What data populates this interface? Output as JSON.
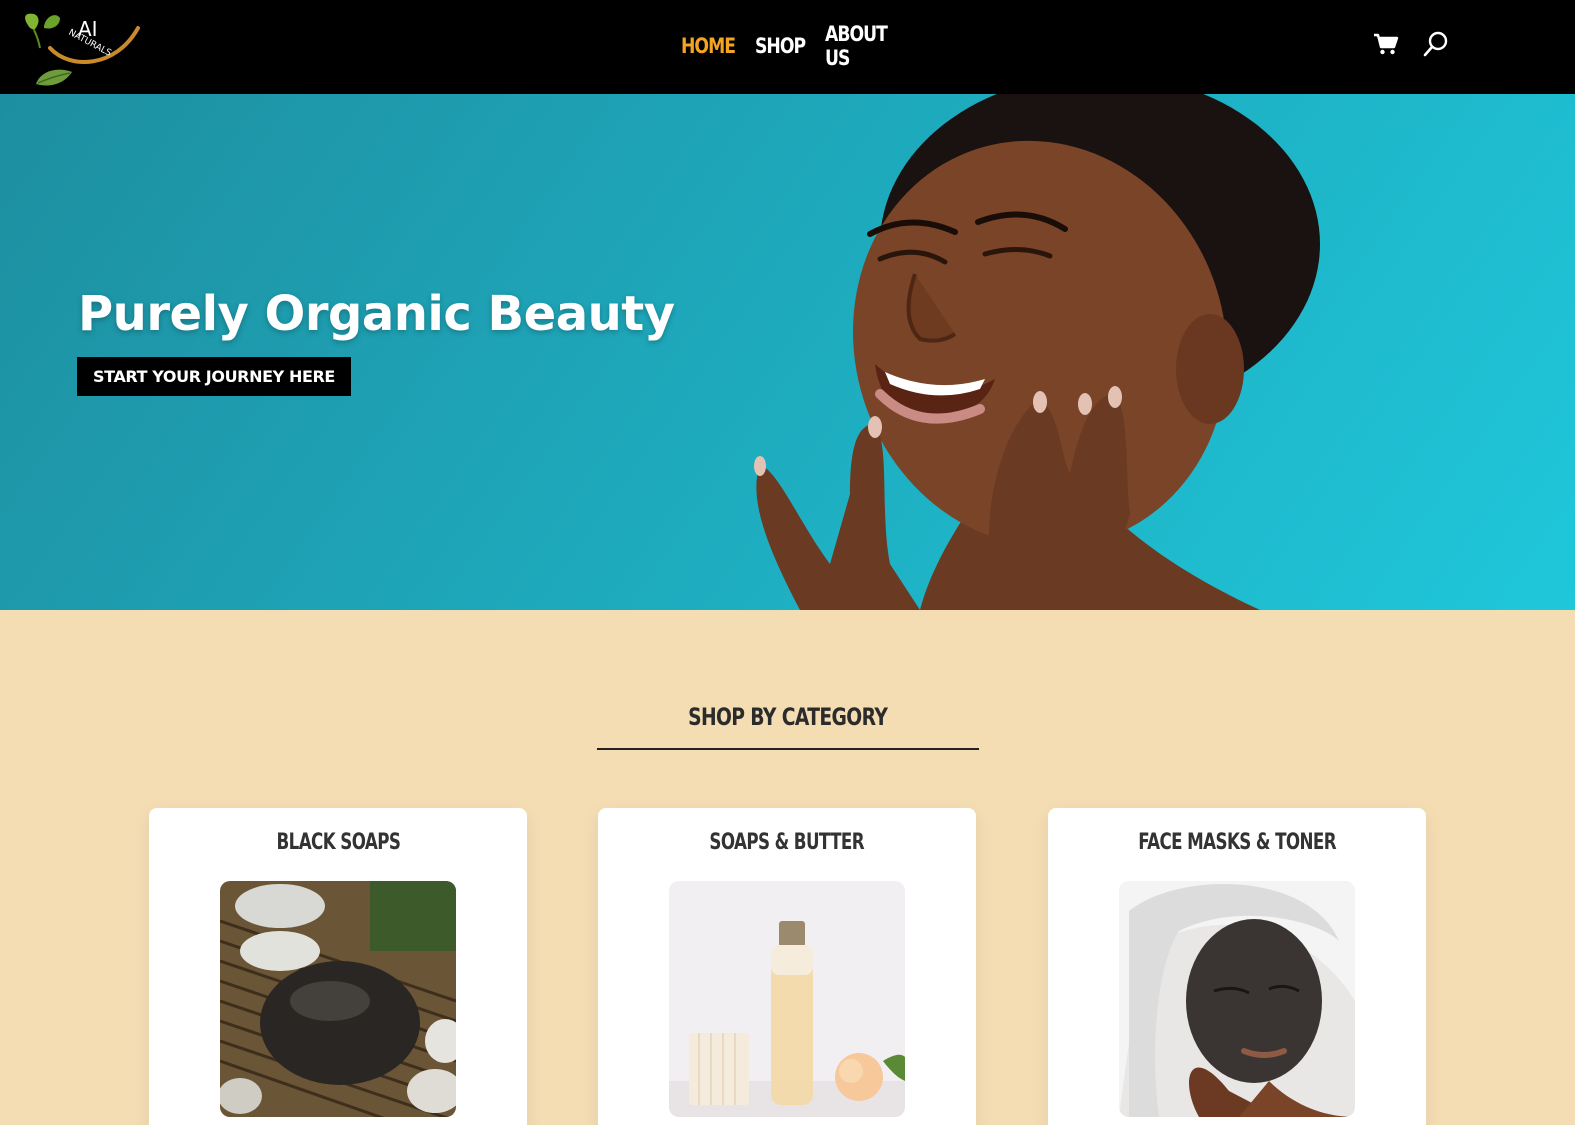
{
  "brand": {
    "logo_text_line1": "AI",
    "logo_text_line2": "NATURALS"
  },
  "nav": {
    "items": [
      {
        "label": "HOME",
        "active": true
      },
      {
        "label": "SHOP",
        "active": false
      },
      {
        "label": "ABOUT US",
        "active": false
      }
    ],
    "active_color": "#f2a422"
  },
  "header_icons": [
    "cart-icon",
    "search-icon"
  ],
  "hero": {
    "title": "Purely Organic Beauty",
    "cta_label": "START YOUR JOURNEY HERE"
  },
  "categories": {
    "title": "SHOP BY CATEGORY",
    "items": [
      {
        "label": "BLACK SOAPS"
      },
      {
        "label": "SOAPS & BUTTER"
      },
      {
        "label": "FACE MASKS & TONER"
      }
    ]
  },
  "colors": {
    "header_bg": "#000000",
    "hero_teal": "#1fb3c7",
    "section_bg": "#f4ddb3",
    "accent": "#f2a422"
  }
}
